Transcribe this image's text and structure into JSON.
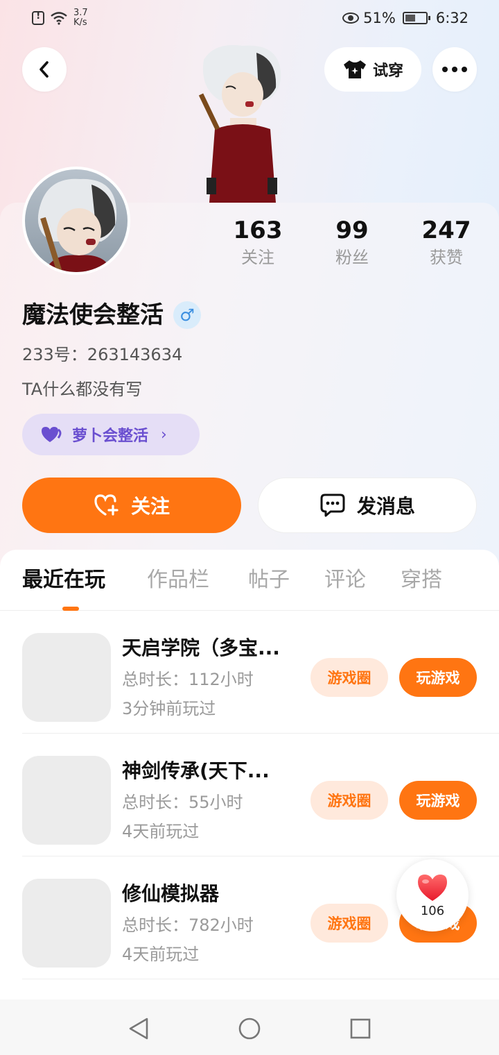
{
  "status_bar": {
    "net_speed_value": "3.7",
    "net_speed_unit": "K/s",
    "battery": "51%",
    "battery_level": 0.51,
    "time": "6:32"
  },
  "header": {
    "try_on_label": "试穿"
  },
  "profile": {
    "stats": [
      {
        "value": "163",
        "label": "关注"
      },
      {
        "value": "99",
        "label": "粉丝"
      },
      {
        "value": "247",
        "label": "获赞"
      }
    ],
    "nickname": "魔法使会整活",
    "gender_symbol": "♂",
    "uid": "233号：263143634",
    "bio": "TA什么都没有写",
    "club_label": "萝卜会整活"
  },
  "actions": {
    "follow_label": "关注",
    "message_label": "发消息"
  },
  "tabs": [
    {
      "label": "最近在玩"
    },
    {
      "label": "作品栏"
    },
    {
      "label": "帖子"
    },
    {
      "label": "评论"
    },
    {
      "label": "穿搭"
    }
  ],
  "games": [
    {
      "title": "天启学院（多宝...",
      "duration": "总时长：112小时",
      "last_played": "3分钟前玩过",
      "circle_label": "游戏圈",
      "play_label": "玩游戏"
    },
    {
      "title": "神剑传承(天下...",
      "duration": "总时长：55小时",
      "last_played": "4天前玩过",
      "circle_label": "游戏圈",
      "play_label": "玩游戏"
    },
    {
      "title": "修仙模拟器",
      "duration": "总时长：782小时",
      "last_played": "4天前玩过",
      "circle_label": "游戏圈",
      "play_label": "玩游戏"
    }
  ],
  "like_fab": {
    "count": "106"
  },
  "colors": {
    "accent": "#ff7512",
    "club": "#6a4fd0",
    "circle_chip_bg": "#ffe9dc"
  }
}
